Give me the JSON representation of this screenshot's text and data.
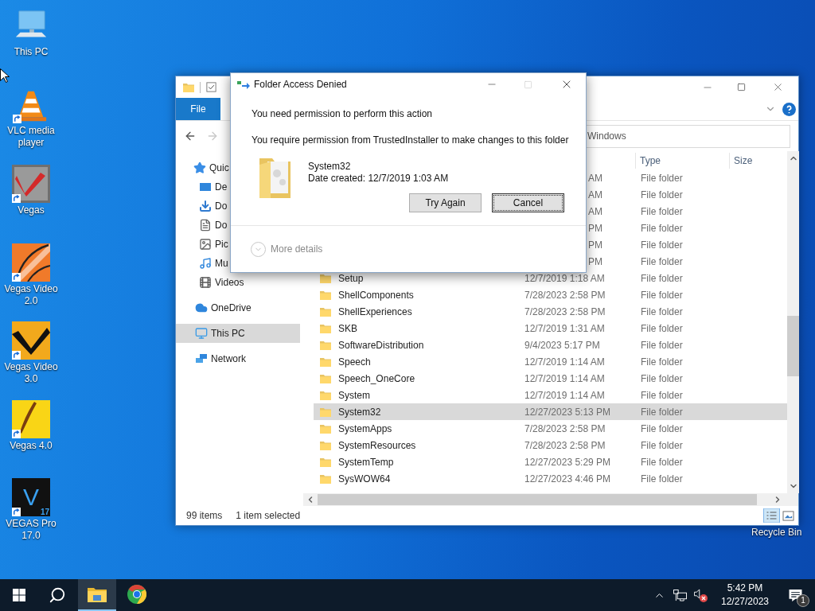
{
  "desktop": {
    "icons": [
      {
        "label": "This PC",
        "kind": "pc",
        "shortcut": false
      },
      {
        "label": "VLC media player",
        "kind": "vlc",
        "shortcut": true
      },
      {
        "label": "Vegas",
        "kind": "vegas",
        "shortcut": true
      },
      {
        "label": "Vegas Video 2.0",
        "kind": "vegas2",
        "shortcut": true
      },
      {
        "label": "Vegas Video 3.0",
        "kind": "vegas3",
        "shortcut": true
      },
      {
        "label": "Vegas 4.0",
        "kind": "vegas4",
        "shortcut": true
      },
      {
        "label": "VEGAS Pro 17.0",
        "kind": "vegas17",
        "shortcut": true,
        "logo_letter": "V",
        "badge": "17"
      }
    ],
    "recycle_bin": {
      "label": "Recycle Bin"
    }
  },
  "explorer": {
    "file_tab": "File",
    "address": "Windows",
    "nav": [
      {
        "label": "Quic",
        "kind": "star",
        "selected": false
      },
      {
        "label": "De",
        "kind": "desktop",
        "selected": false
      },
      {
        "label": "Do",
        "kind": "download",
        "selected": false
      },
      {
        "label": "Do",
        "kind": "document",
        "selected": false
      },
      {
        "label": "Pic",
        "kind": "picture",
        "selected": false
      },
      {
        "label": "Mu",
        "kind": "music",
        "selected": false
      },
      {
        "label": "Videos",
        "kind": "video",
        "selected": false
      },
      {
        "label": "OneDrive",
        "kind": "cloud",
        "selected": false
      },
      {
        "label": "This PC",
        "kind": "pc",
        "selected": true
      },
      {
        "label": "Network",
        "kind": "network",
        "selected": false
      }
    ],
    "columns": [
      {
        "label": "Type"
      },
      {
        "label": "Size"
      }
    ],
    "rows": [
      {
        "kind": "covered",
        "date": "AM",
        "type": "File folder",
        "selected": false
      },
      {
        "kind": "covered",
        "date": "AM",
        "type": "File folder",
        "selected": false
      },
      {
        "kind": "covered",
        "date": "AM",
        "type": "File folder",
        "selected": false
      },
      {
        "kind": "covered",
        "date": "PM",
        "type": "File folder",
        "selected": false
      },
      {
        "kind": "covered",
        "date": "PM",
        "type": "File folder",
        "selected": false
      },
      {
        "kind": "covered",
        "date": "PM",
        "type": "File folder",
        "selected": false
      },
      {
        "kind": "folder",
        "name": "Setup",
        "date": "12/7/2019 1:18 AM",
        "type": "File folder",
        "selected": false
      },
      {
        "kind": "folder",
        "name": "ShellComponents",
        "date": "7/28/2023 2:58 PM",
        "type": "File folder",
        "selected": false
      },
      {
        "kind": "folder",
        "name": "ShellExperiences",
        "date": "7/28/2023 2:58 PM",
        "type": "File folder",
        "selected": false
      },
      {
        "kind": "folder",
        "name": "SKB",
        "date": "12/7/2019 1:31 AM",
        "type": "File folder",
        "selected": false
      },
      {
        "kind": "folder",
        "name": "SoftwareDistribution",
        "date": "9/4/2023 5:17 PM",
        "type": "File folder",
        "selected": false
      },
      {
        "kind": "folder",
        "name": "Speech",
        "date": "12/7/2019 1:14 AM",
        "type": "File folder",
        "selected": false
      },
      {
        "kind": "folder",
        "name": "Speech_OneCore",
        "date": "12/7/2019 1:14 AM",
        "type": "File folder",
        "selected": false
      },
      {
        "kind": "folder",
        "name": "System",
        "date": "12/7/2019 1:14 AM",
        "type": "File folder",
        "selected": false
      },
      {
        "kind": "folder",
        "name": "System32",
        "date": "12/27/2023 5:13 PM",
        "type": "File folder",
        "selected": true
      },
      {
        "kind": "folder",
        "name": "SystemApps",
        "date": "7/28/2023 2:58 PM",
        "type": "File folder",
        "selected": false
      },
      {
        "kind": "folder",
        "name": "SystemResources",
        "date": "7/28/2023 2:58 PM",
        "type": "File folder",
        "selected": false
      },
      {
        "kind": "folder",
        "name": "SystemTemp",
        "date": "12/27/2023 5:29 PM",
        "type": "File folder",
        "selected": false
      },
      {
        "kind": "folder",
        "name": "SysWOW64",
        "date": "12/27/2023 4:46 PM",
        "type": "File folder",
        "selected": false
      }
    ],
    "status": {
      "count": "99 items",
      "selection": "1 item selected"
    }
  },
  "dialog": {
    "title": "Folder Access Denied",
    "heading": "You need permission to perform this action",
    "message": "You require permission from TrustedInstaller to make changes to this folder",
    "item": {
      "name": "System32",
      "detail": "Date created: 12/7/2019 1:03 AM"
    },
    "buttons": [
      {
        "label": "Try Again",
        "focused": false
      },
      {
        "label": "Cancel",
        "focused": true
      }
    ],
    "more_details": "More details"
  },
  "taskbar": {
    "apps": [
      {
        "kind": "explorer",
        "active": true
      },
      {
        "kind": "chrome",
        "active": false
      }
    ],
    "volume_muted": true,
    "clock": {
      "time": "5:42 PM",
      "date": "12/27/2023"
    },
    "notifications": "1"
  }
}
